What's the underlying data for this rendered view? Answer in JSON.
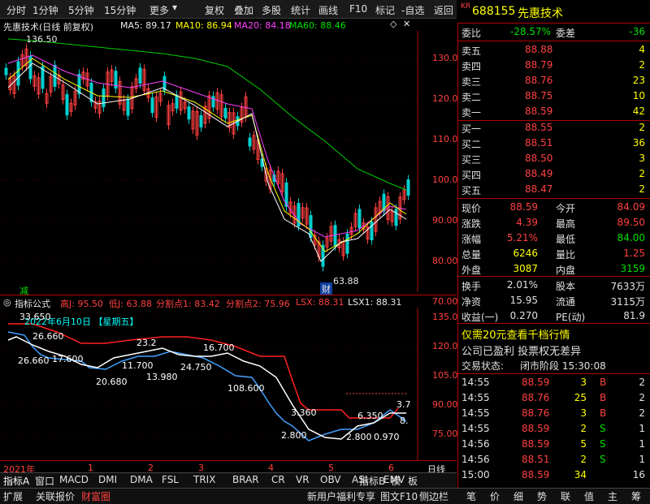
{
  "toolbar": {
    "items": [
      "分时",
      "1分钟",
      "5分钟",
      "15分钟",
      "更多",
      "复权",
      "叠加",
      "多股",
      "统计",
      "画线",
      "F10",
      "标记",
      "-自选",
      "返回"
    ]
  },
  "stock": {
    "badge": "KR",
    "code": "688155",
    "name": "先惠技术"
  },
  "main_header": {
    "title": "先惠技术(日线 前复权)",
    "ma5": "MA5: 89.17",
    "ma10": "MA10: 86.94",
    "ma20": "MA20: 84.18",
    "ma60": "MA60: 88.46"
  },
  "main_chart": {
    "y_ticks": [
      "130.0",
      "120.0",
      "110.0",
      "100.0",
      "90.00",
      "80.00",
      "70.00"
    ],
    "high_label": "136.50",
    "low_label": "63.88",
    "jian_label": "减",
    "cai_label": "财"
  },
  "indicator_header": {
    "name": "指标公式",
    "high": "高J: 95.50",
    "low": "低J: 63.88",
    "split1": "分割点1: 83.42",
    "split2": "分割点2: 75.96",
    "lsx": "LSX: 88.31",
    "lsx1": "LSX1: 88.31"
  },
  "indicator_chart": {
    "y_ticks": [
      "135.0",
      "120.0",
      "105.0",
      "90.00",
      "75.00"
    ],
    "date_label": "2022年6月10日 【星期五】",
    "price_labels": [
      "33.650",
      "26.660",
      "26.660",
      "17.600",
      "11.700",
      "13.980",
      "20.680",
      "24.750",
      "23.2",
      "16.700",
      "108.600",
      "3.360",
      "2.800",
      "6.350",
      "2.800",
      "0.970",
      "3.7",
      "8."
    ]
  },
  "time_axis": {
    "year": "2021年",
    "months": [
      "1",
      "2",
      "3",
      "4",
      "5",
      "6"
    ],
    "period": "日线"
  },
  "quote": {
    "weibi_label": "委比",
    "weibi": "-28.57%",
    "weicha_label": "委差",
    "weicha": "-36",
    "asks": [
      {
        "label": "卖五",
        "price": "88.88",
        "vol": "4"
      },
      {
        "label": "卖四",
        "price": "88.79",
        "vol": "2"
      },
      {
        "label": "卖三",
        "price": "88.76",
        "vol": "23"
      },
      {
        "label": "卖二",
        "price": "88.75",
        "vol": "10"
      },
      {
        "label": "卖一",
        "price": "88.59",
        "vol": "42"
      }
    ],
    "bids": [
      {
        "label": "买一",
        "price": "88.55",
        "vol": "2"
      },
      {
        "label": "买二",
        "price": "88.51",
        "vol": "36"
      },
      {
        "label": "买三",
        "price": "88.50",
        "vol": "3"
      },
      {
        "label": "买四",
        "price": "88.49",
        "vol": "2"
      },
      {
        "label": "买五",
        "price": "88.47",
        "vol": "2"
      }
    ],
    "stats": [
      {
        "l1": "现价",
        "v1": "88.59",
        "l2": "今开",
        "v2": "84.09"
      },
      {
        "l1": "涨跌",
        "v1": "4.39",
        "l2": "最高",
        "v2": "89.50"
      },
      {
        "l1": "涨幅",
        "v1": "5.21%",
        "l2": "最低",
        "v2": "84.00"
      },
      {
        "l1": "总量",
        "v1": "6246",
        "l2": "量比",
        "v2": "1.25"
      },
      {
        "l1": "外盘",
        "v1": "3087",
        "l2": "内盘",
        "v2": "3159"
      }
    ],
    "stats2": [
      {
        "l1": "换手",
        "v1": "2.01%",
        "l2": "股本",
        "v2": "7633万"
      },
      {
        "l1": "净资",
        "v1": "15.95",
        "l2": "流通",
        "v2": "3115万"
      },
      {
        "l1": "收益(一)",
        "v1": "0.270",
        "l2": "PE(动)",
        "v2": "81.9"
      }
    ],
    "promo": "仅需20元查看千档行情",
    "notice": "公司已盈利 投票权无差异",
    "status_label": "交易状态:",
    "status_value": "闭市阶段 15:30:08"
  },
  "ticks": [
    {
      "time": "14:55",
      "price": "88.59",
      "vol": "3",
      "side": "B",
      "n": "2"
    },
    {
      "time": "14:55",
      "price": "88.76",
      "vol": "25",
      "side": "B",
      "n": "2"
    },
    {
      "time": "14:55",
      "price": "88.76",
      "vol": "3",
      "side": "B",
      "n": "2"
    },
    {
      "time": "14:55",
      "price": "88.59",
      "vol": "2",
      "side": "S",
      "n": "1"
    },
    {
      "time": "14:56",
      "price": "88.59",
      "vol": "5",
      "side": "S",
      "n": "1"
    },
    {
      "time": "14:56",
      "price": "88.51",
      "vol": "2",
      "side": "S",
      "n": "1"
    },
    {
      "time": "15:00",
      "price": "88.59",
      "vol": "34",
      "side": "",
      "n": "16"
    }
  ],
  "bottom_tabs": [
    "指标A",
    "窗口",
    "MACD",
    "DMI",
    "DMA",
    "FSL",
    "TRIX",
    "BRAR",
    "CR",
    "VR",
    "OBV",
    "ASI",
    "EMV",
    "指标B",
    "模",
    "板"
  ],
  "bottom_tabs2": [
    "扩展",
    "关联报价",
    "财富圈",
    "新用户福利专享",
    "图文F10",
    "侧边栏"
  ],
  "side_tabs": [
    "笔",
    "价",
    "细",
    "势",
    "联",
    "值",
    "主",
    "筹"
  ],
  "colors": {
    "up": "#ff4040",
    "down": "#00e000",
    "panel": "#000000",
    "accent_red": "#b00000"
  }
}
